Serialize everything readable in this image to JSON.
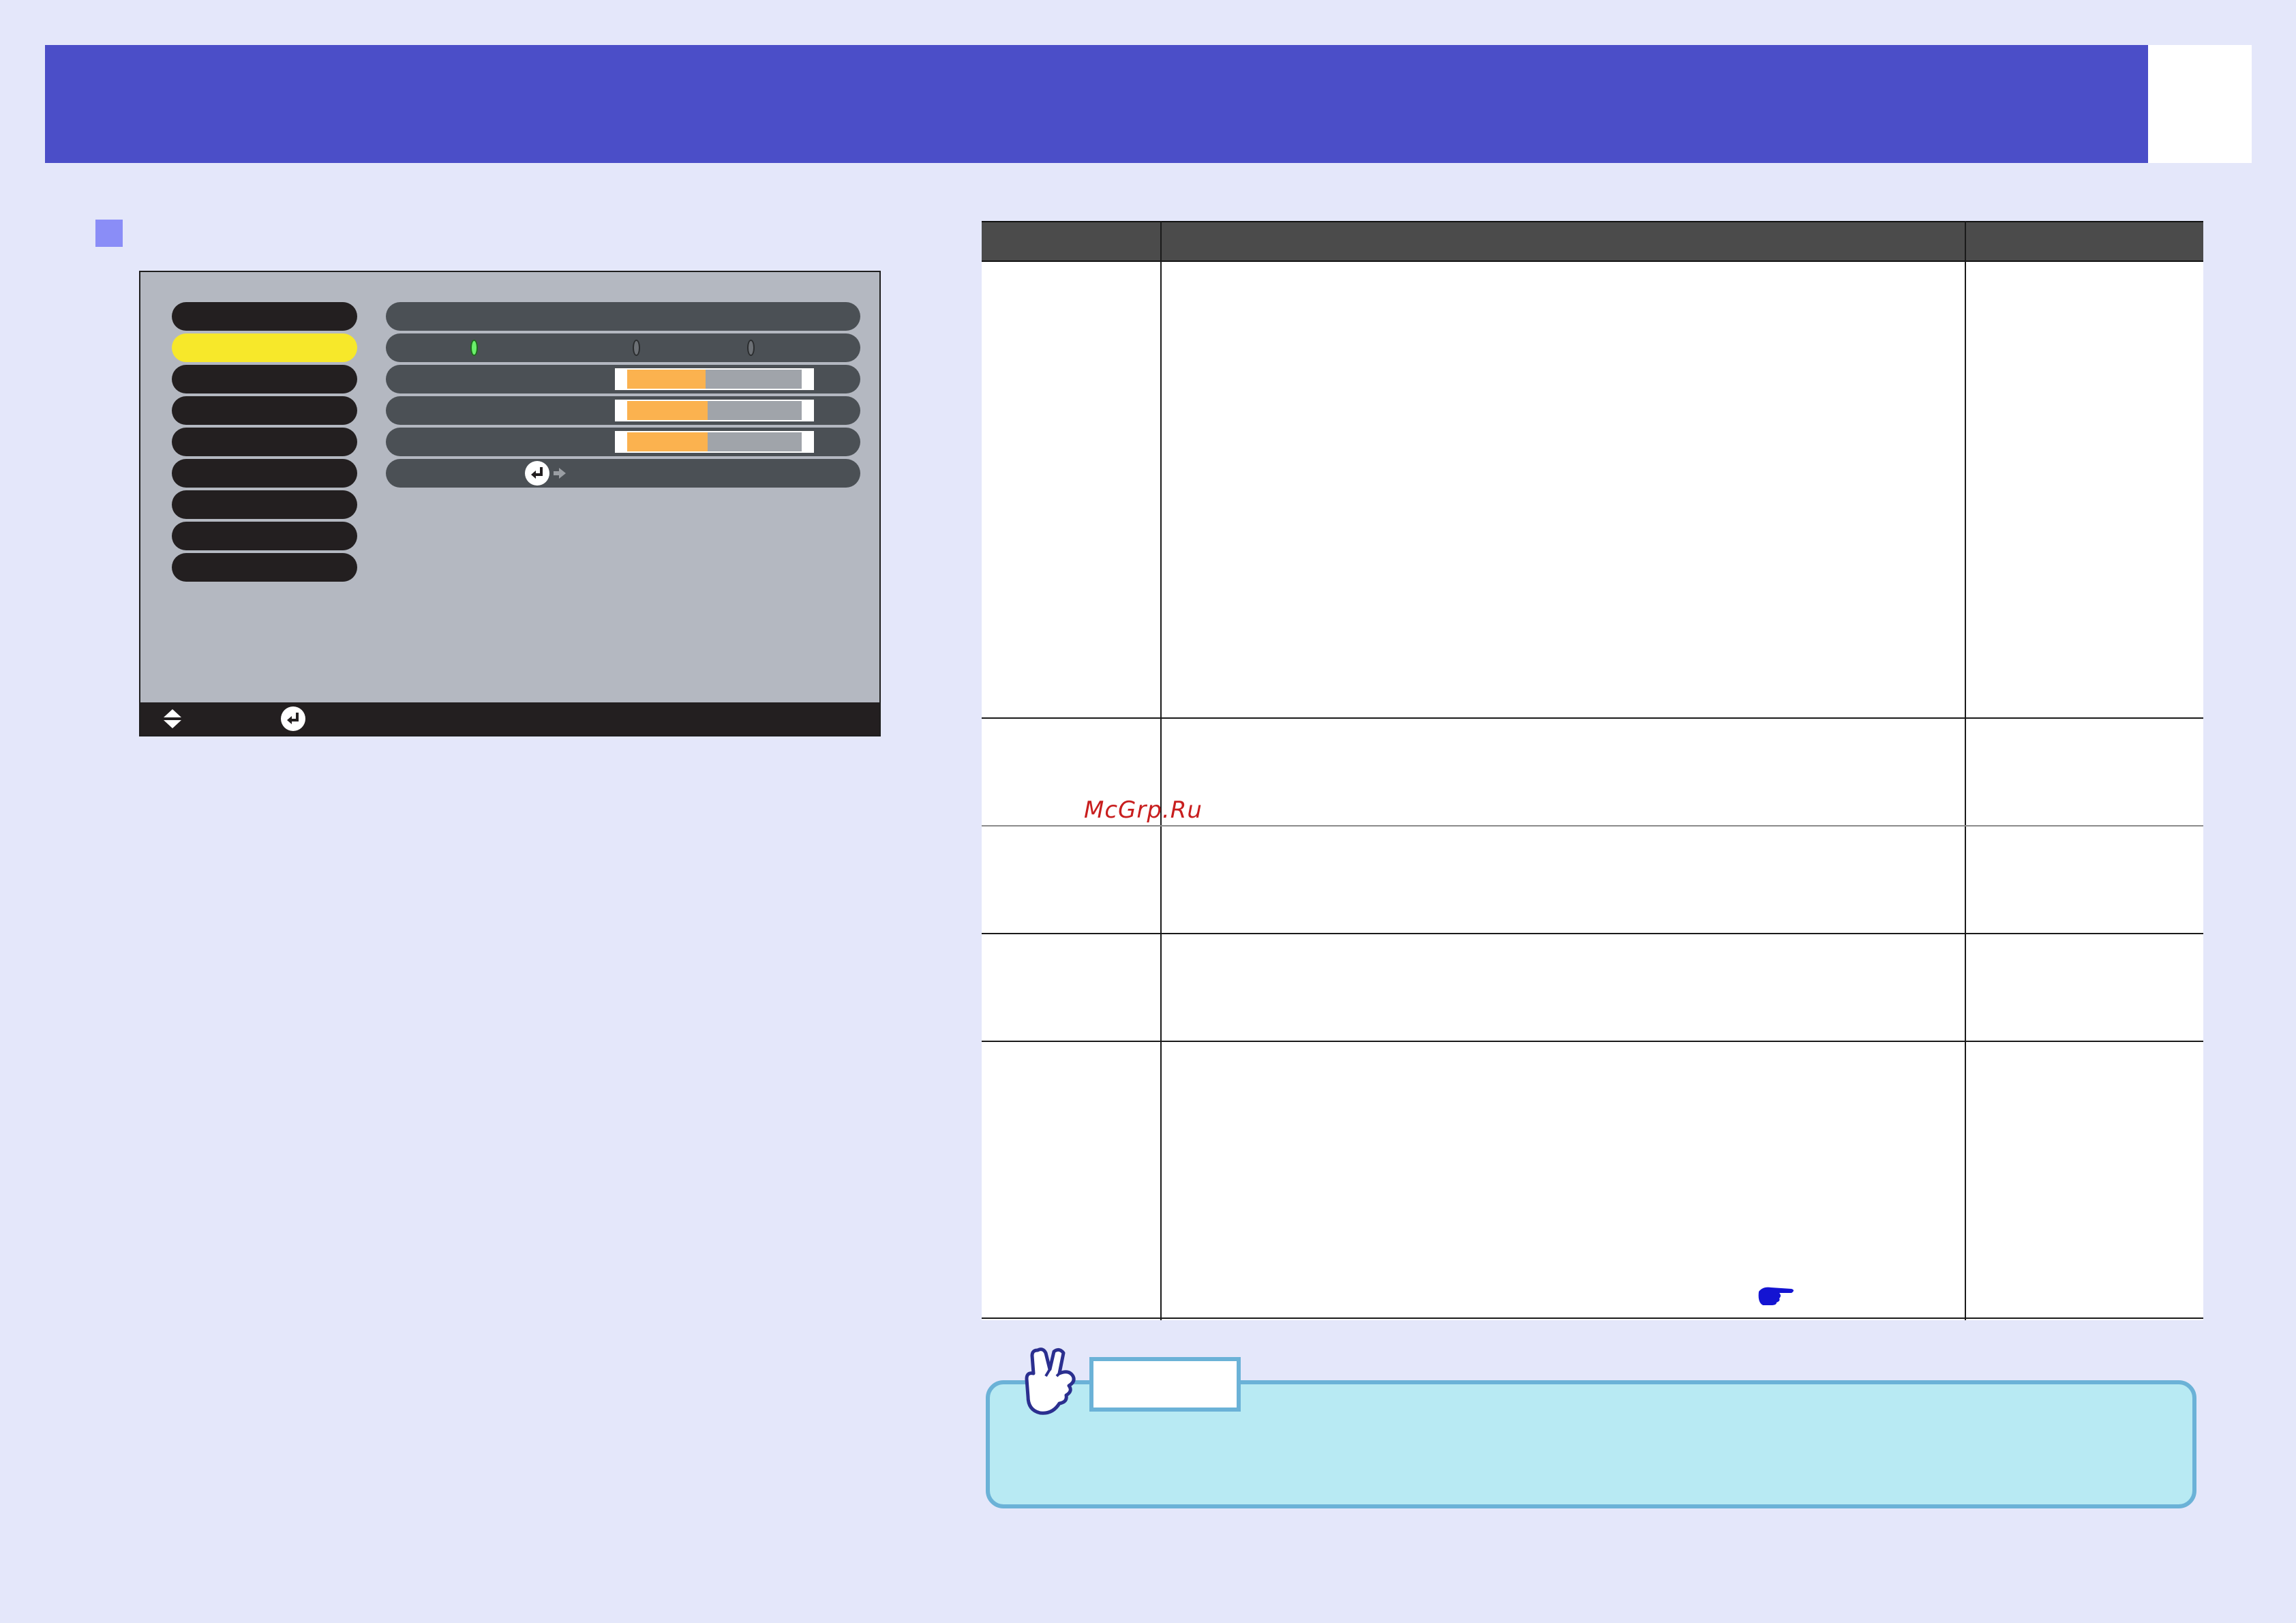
{
  "header": {
    "title": "",
    "page_number": ""
  },
  "section": {
    "marker_icon": "square-bullet-icon",
    "title": ""
  },
  "osd_menu": {
    "sidebar_items": [
      "",
      "",
      "",
      "",
      "",
      "",
      "",
      "",
      ""
    ],
    "active_index": 1,
    "rows": [
      {
        "type": "label",
        "label": ""
      },
      {
        "type": "radio",
        "label": "",
        "options": [
          "",
          "",
          ""
        ],
        "selected": 0
      },
      {
        "type": "slider",
        "label": "",
        "level": 0.45
      },
      {
        "type": "slider",
        "label": "",
        "level": 0.46
      },
      {
        "type": "slider",
        "label": "",
        "level": 0.46
      },
      {
        "type": "enter",
        "label": ""
      }
    ],
    "footer": {
      "select_icon": "up-down-arrows-icon",
      "enter_icon": "enter-icon",
      "select_label": "",
      "enter_label": ""
    }
  },
  "table": {
    "headers": [
      "",
      "",
      ""
    ],
    "rows": [
      {
        "cells": [
          "",
          "",
          ""
        ]
      },
      {
        "cells": [
          "",
          "",
          ""
        ]
      },
      {
        "cells": [
          "",
          "",
          ""
        ]
      },
      {
        "cells": [
          "",
          "",
          ""
        ]
      },
      {
        "cells": [
          "",
          "",
          ""
        ],
        "icon": "pointing-hand-icon"
      }
    ]
  },
  "watermark": "McGrp.Ru",
  "note": {
    "label": "",
    "icon": "hand-tip-icon",
    "text": ""
  },
  "colors": {
    "background": "#e4e7fa",
    "header": "#4b4ec8",
    "accent_marker": "#8a8df7",
    "menu_active": "#f7e82a",
    "slider_fill": "#fbb24f",
    "radio_on": "#6af06a",
    "note_fill": "#b8eaf3",
    "note_border": "#6bb2d7",
    "watermark": "#c81e1e",
    "pointer": "#1414d2"
  }
}
